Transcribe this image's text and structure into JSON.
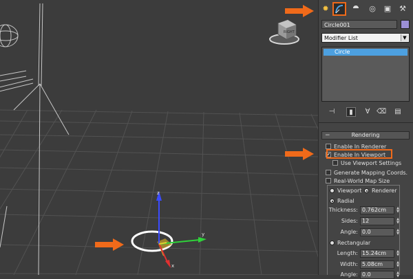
{
  "viewport": {
    "viewcube_label": "RIGHT",
    "gizmo": {
      "x_label": "x",
      "y_label": "y",
      "z_label": "z"
    }
  },
  "command_panel": {
    "tabs": [
      {
        "name": "create",
        "icon": "sun-icon",
        "glyph": "✹"
      },
      {
        "name": "modify",
        "icon": "modify-curve-icon",
        "glyph": "⌒"
      },
      {
        "name": "hierarchy",
        "icon": "hierarchy-icon",
        "glyph": "⯊"
      },
      {
        "name": "motion",
        "icon": "motion-icon",
        "glyph": "◎"
      },
      {
        "name": "display",
        "icon": "display-icon",
        "glyph": "▣"
      },
      {
        "name": "utilities",
        "icon": "hammer-icon",
        "glyph": "⚒"
      }
    ],
    "object_name": "Circle001",
    "object_color": "#9b8fd6",
    "modifier_list_label": "Modifier List",
    "stack": [
      {
        "label": "Circle",
        "selected": true
      }
    ],
    "stack_tools": [
      "pin-stack-icon",
      "show-end-result-icon",
      "make-unique-icon",
      "remove-modifier-icon",
      "configure-sets-icon"
    ],
    "rendering": {
      "title": "Rendering",
      "enable_in_renderer": {
        "label": "Enable In Renderer",
        "checked": false
      },
      "enable_in_viewport": {
        "label": "Enable In Viewport",
        "checked": true
      },
      "use_viewport_settings": {
        "label": "Use Viewport Settings",
        "checked": false
      },
      "generate_mapping": {
        "label": "Generate Mapping Coords.",
        "checked": false
      },
      "real_world_map": {
        "label": "Real-World Map Size",
        "checked": false
      },
      "viewport_radio": {
        "label": "Viewport",
        "selected": false
      },
      "renderer_radio": {
        "label": "Renderer",
        "selected": true
      },
      "radial": {
        "label": "Radial",
        "selected": true
      },
      "thickness": {
        "label": "Thickness:",
        "value": "0.762cm"
      },
      "sides": {
        "label": "Sides:",
        "value": "12"
      },
      "angle": {
        "label": "Angle:",
        "value": "0.0"
      },
      "rectangular": {
        "label": "Rectangular",
        "selected": false
      },
      "length": {
        "label": "Length:",
        "value": "15.24cm"
      },
      "width": {
        "label": "Width:",
        "value": "5.08cm"
      },
      "angle2": {
        "label": "Angle:",
        "value": "0.0"
      }
    }
  },
  "annotation_color": "#f06a1a"
}
